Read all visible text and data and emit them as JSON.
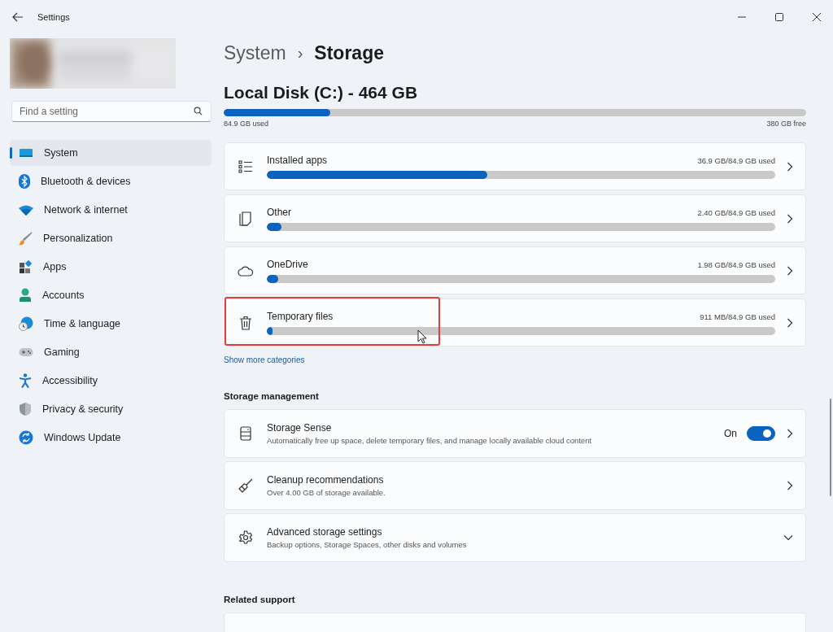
{
  "window": {
    "title": "Settings"
  },
  "search": {
    "placeholder": "Find a setting"
  },
  "nav": [
    {
      "label": "System",
      "selected": true
    },
    {
      "label": "Bluetooth & devices",
      "selected": false
    },
    {
      "label": "Network & internet",
      "selected": false
    },
    {
      "label": "Personalization",
      "selected": false
    },
    {
      "label": "Apps",
      "selected": false
    },
    {
      "label": "Accounts",
      "selected": false
    },
    {
      "label": "Time & language",
      "selected": false
    },
    {
      "label": "Gaming",
      "selected": false
    },
    {
      "label": "Accessibility",
      "selected": false
    },
    {
      "label": "Privacy & security",
      "selected": false
    },
    {
      "label": "Windows Update",
      "selected": false
    }
  ],
  "breadcrumb": {
    "parent": "System",
    "separator": "›",
    "current": "Storage"
  },
  "disk": {
    "title": "Local Disk (C:) - 464 GB",
    "level": 0.183,
    "used": "84.9 GB used",
    "free": "380 GB free"
  },
  "categories": [
    {
      "name": "Installed apps",
      "usage": "36.9 GB/84.9 GB used",
      "level": 0.434,
      "highlighted": false
    },
    {
      "name": "Other",
      "usage": "2.40 GB/84.9 GB used",
      "level": 0.028,
      "highlighted": false
    },
    {
      "name": "OneDrive",
      "usage": "1.98 GB/84.9 GB used",
      "level": 0.023,
      "highlighted": false
    },
    {
      "name": "Temporary files",
      "usage": "911 MB/84.9 GB used",
      "level": 0.011,
      "highlighted": true
    }
  ],
  "show_more": "Show more categories",
  "management": {
    "heading": "Storage management",
    "items": [
      {
        "kind": "toggle",
        "title": "Storage Sense",
        "subtitle": "Automatically free up space, delete temporary files, and manage locally available cloud content",
        "toggle_label": "On",
        "on": true
      },
      {
        "kind": "link",
        "title": "Cleanup recommendations",
        "subtitle": "Over 4.00 GB of storage available."
      },
      {
        "kind": "expander",
        "title": "Advanced storage settings",
        "subtitle": "Backup options, Storage Spaces, other disks and volumes"
      }
    ]
  },
  "related": {
    "heading": "Related support"
  }
}
